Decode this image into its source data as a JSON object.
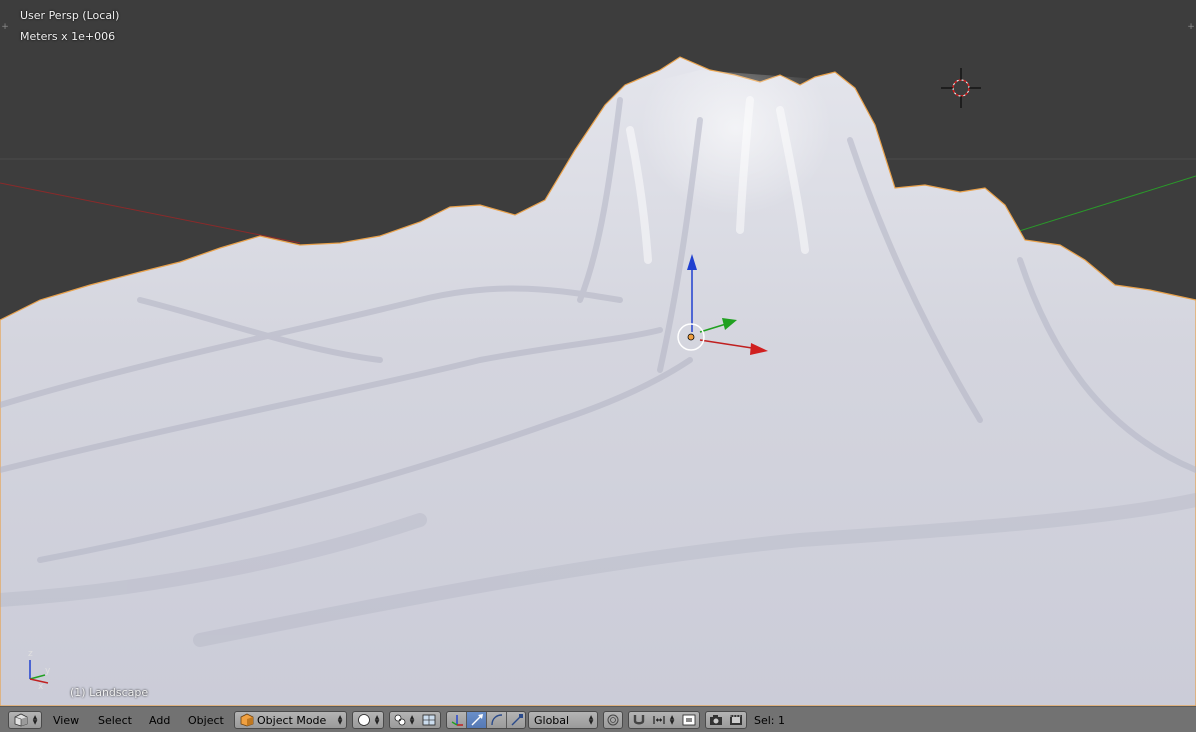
{
  "viewport": {
    "view_name": "User Persp (Local)",
    "units": "Meters x 1e+006",
    "active_object": "(1) Landscape",
    "axis_labels": {
      "x": "x",
      "y": "y",
      "z": "z"
    },
    "colors": {
      "background": "#3d3d3d",
      "terrain": "#d8d9e2",
      "selection_outline": "#f0a040",
      "axis_x": "#c02020",
      "axis_y": "#20a020",
      "axis_z": "#2040d0",
      "cursor": "#d02020"
    }
  },
  "header": {
    "editor_type_icon": "cube-icon",
    "menus": [
      {
        "label": "View"
      },
      {
        "label": "Select"
      },
      {
        "label": "Add"
      },
      {
        "label": "Object"
      }
    ],
    "mode": {
      "label": "Object Mode",
      "icon": "orange-cube-icon"
    },
    "viewport_shading_icon": "sphere-shading-icon",
    "pivot_icon": "pivot-icon",
    "manipulator_icons": [
      "manipulator-toggle-icon",
      "translate-icon",
      "rotate-icon",
      "scale-icon"
    ],
    "transform_orientation": "Global",
    "proportional_icon": "proportional-editing-icon",
    "snap_icons": [
      "snap-magnet-icon",
      "snap-element-icon"
    ],
    "render_icons": [
      "render-still-icon",
      "render-animation-icon"
    ],
    "selection_count": "Sel: 1",
    "colors": {
      "bar": "#727272",
      "button": "#a8a8a8",
      "active": "#5a7fbf"
    }
  }
}
